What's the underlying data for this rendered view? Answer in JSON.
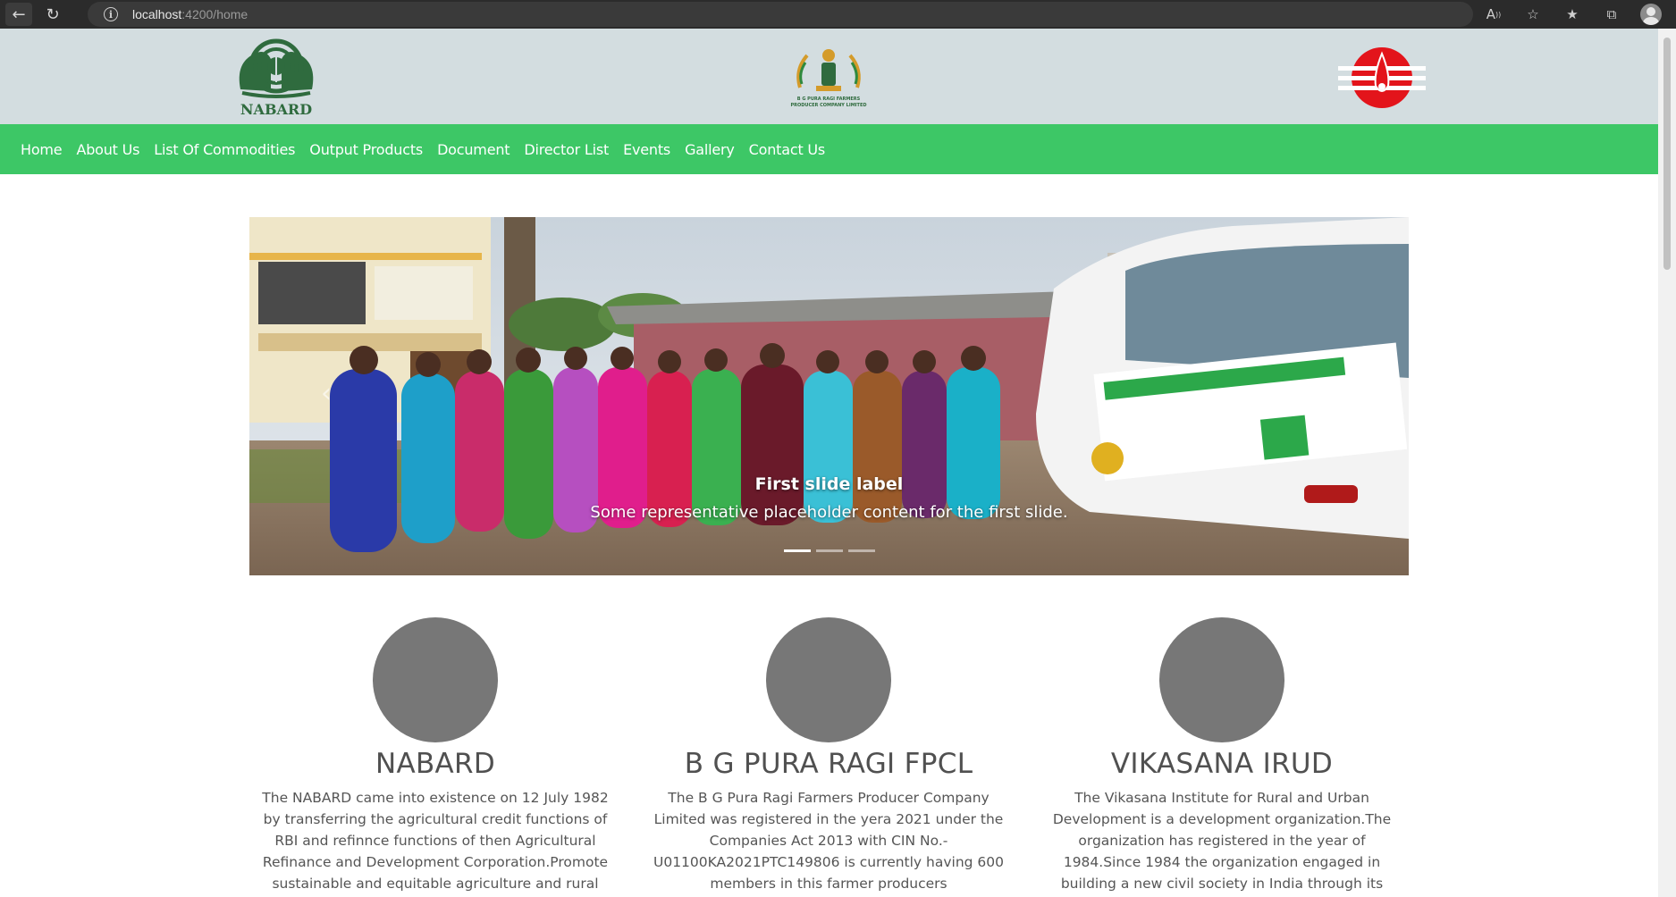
{
  "browser": {
    "url_host": "localhost",
    "url_rest": ":4200/home",
    "back_icon": "back-arrow-icon",
    "reload_icon": "reload-icon",
    "info_icon": "site-info-icon"
  },
  "header": {
    "nabard_logo_text": "NABARD",
    "fpcl_logo_text": "B G PURA RAGI FARMERS PRODUCER COMPANY LIMITED"
  },
  "nav": {
    "items": [
      "Home",
      "About Us",
      "List Of Commodities",
      "Output Products",
      "Document",
      "Director List",
      "Events",
      "Gallery",
      "Contact Us"
    ]
  },
  "carousel": {
    "caption_title": "First slide label",
    "caption_text": "Some representative placeholder content for the first slide.",
    "active_slide": 1,
    "slide_count": 3
  },
  "cards": [
    {
      "title": "NABARD",
      "text": "The NABARD came into existence on 12 July 1982 by transferring the agricultural credit functions of RBI and refinnce functions of then Agricultural Refinance and Development Corporation.Promote sustainable and equitable agriculture and rural development through"
    },
    {
      "title": "B G PURA RAGI FPCL",
      "text": "The B G Pura Ragi Farmers Producer Company Limited was registered in the yera 2021 under the Companies Act 2013 with CIN No.-U01100KA2021PTC149806 is currently having 600 members in this farmer producers company.Vikasana IRUD is the facilitating agency.FPCL"
    },
    {
      "title": "VIKASANA IRUD",
      "text": "The Vikasana Institute for Rural and Urban Development is a development organization.The organization has registered in the year of 1984.Since 1984 the organization engaged in building a new civil society in India through its grassroots to policy level"
    }
  ],
  "colors": {
    "navbar": "#3dc766",
    "header": "#d3dde0",
    "avatar": "#777777"
  }
}
